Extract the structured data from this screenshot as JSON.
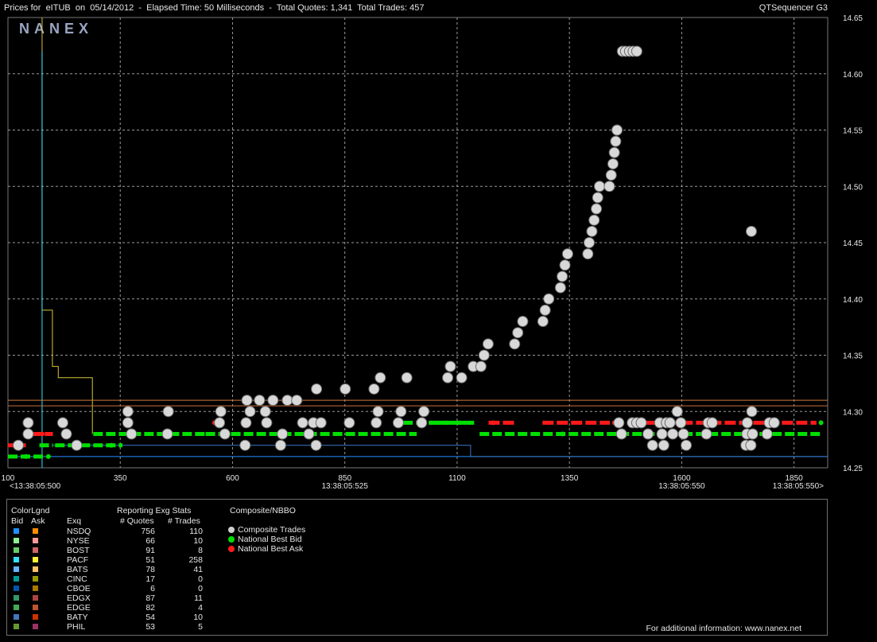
{
  "header": {
    "title": "Prices for  eITUB  on  05/14/2012  -  Elapsed Time: 50 Milliseconds  -  Total Quotes: 1,341  Total Trades: 457",
    "app_name": "QTSequencer G3",
    "watermark": "NANEX"
  },
  "chart_data": {
    "type": "scatter",
    "x_ticks": [
      {
        "value": 100,
        "label": "100"
      },
      {
        "value": 350,
        "label": "350"
      },
      {
        "value": 600,
        "label": "600"
      },
      {
        "value": 850,
        "label": "850"
      },
      {
        "value": 1100,
        "label": "1100"
      },
      {
        "value": 1350,
        "label": "1350"
      },
      {
        "value": 1600,
        "label": "1600"
      },
      {
        "value": 1850,
        "label": "1850"
      }
    ],
    "time_labels": [
      {
        "value": 100,
        "label": "<13:38:05:500"
      },
      {
        "value": 850,
        "label": "13:38:05:525"
      },
      {
        "value": 1600,
        "label": "13:38:05:550"
      },
      {
        "value": 1925,
        "label": "13:38:05:550>"
      }
    ],
    "y_ticks": [
      14.25,
      14.3,
      14.35,
      14.4,
      14.45,
      14.5,
      14.55,
      14.6,
      14.65
    ],
    "xlim": [
      100,
      1925
    ],
    "ylim": [
      14.25,
      14.65
    ],
    "grid": true,
    "colors": {
      "trades": "#d8d8d8",
      "bid": "#00e000",
      "ask": "#ff1a1a",
      "grid": "#9a9a9a"
    },
    "composite_trades": [
      [
        123,
        14.27
      ],
      [
        145,
        14.28
      ],
      [
        145,
        14.29
      ],
      [
        222,
        14.29
      ],
      [
        230,
        14.28
      ],
      [
        253,
        14.27
      ],
      [
        367,
        14.29
      ],
      [
        367,
        14.3
      ],
      [
        375,
        14.28
      ],
      [
        455,
        14.28
      ],
      [
        457,
        14.3
      ],
      [
        571,
        14.29
      ],
      [
        574,
        14.3
      ],
      [
        583,
        14.28
      ],
      [
        628,
        14.27
      ],
      [
        630,
        14.29
      ],
      [
        632,
        14.31
      ],
      [
        639,
        14.3
      ],
      [
        660,
        14.31
      ],
      [
        673,
        14.3
      ],
      [
        676,
        14.29
      ],
      [
        690,
        14.31
      ],
      [
        707,
        14.27
      ],
      [
        711,
        14.28
      ],
      [
        722,
        14.31
      ],
      [
        743,
        14.31
      ],
      [
        756,
        14.29
      ],
      [
        770,
        14.28
      ],
      [
        780,
        14.29
      ],
      [
        786,
        14.27
      ],
      [
        787,
        14.32
      ],
      [
        797,
        14.29
      ],
      [
        851,
        14.32
      ],
      [
        860,
        14.29
      ],
      [
        915,
        14.32
      ],
      [
        920,
        14.29
      ],
      [
        924,
        14.3
      ],
      [
        929,
        14.33
      ],
      [
        969,
        14.29
      ],
      [
        975,
        14.3
      ],
      [
        988,
        14.33
      ],
      [
        1021,
        14.29
      ],
      [
        1026,
        14.3
      ],
      [
        1079,
        14.33
      ],
      [
        1085,
        14.34
      ],
      [
        1110,
        14.33
      ],
      [
        1136,
        14.34
      ],
      [
        1153,
        14.34
      ],
      [
        1160,
        14.35
      ],
      [
        1169,
        14.36
      ],
      [
        1228,
        14.36
      ],
      [
        1235,
        14.37
      ],
      [
        1246,
        14.38
      ],
      [
        1291,
        14.38
      ],
      [
        1296,
        14.39
      ],
      [
        1304,
        14.4
      ],
      [
        1330,
        14.41
      ],
      [
        1334,
        14.42
      ],
      [
        1340,
        14.43
      ],
      [
        1346,
        14.44
      ],
      [
        1391,
        14.44
      ],
      [
        1394,
        14.45
      ],
      [
        1400,
        14.46
      ],
      [
        1405,
        14.47
      ],
      [
        1410,
        14.48
      ],
      [
        1413,
        14.49
      ],
      [
        1417,
        14.5
      ],
      [
        1439,
        14.5
      ],
      [
        1443,
        14.51
      ],
      [
        1447,
        14.52
      ],
      [
        1450,
        14.53
      ],
      [
        1453,
        14.54
      ],
      [
        1456,
        14.55
      ],
      [
        1468,
        14.62
      ],
      [
        1475,
        14.62
      ],
      [
        1484,
        14.62
      ],
      [
        1492,
        14.62
      ],
      [
        1500,
        14.62
      ],
      [
        1460,
        14.29
      ],
      [
        1466,
        14.28
      ],
      [
        1490,
        14.29
      ],
      [
        1500,
        14.29
      ],
      [
        1510,
        14.29
      ],
      [
        1525,
        14.28
      ],
      [
        1535,
        14.27
      ],
      [
        1551,
        14.29
      ],
      [
        1556,
        14.28
      ],
      [
        1560,
        14.27
      ],
      [
        1566,
        14.29
      ],
      [
        1574,
        14.29
      ],
      [
        1580,
        14.28
      ],
      [
        1590,
        14.3
      ],
      [
        1598,
        14.29
      ],
      [
        1604,
        14.28
      ],
      [
        1610,
        14.27
      ],
      [
        1655,
        14.28
      ],
      [
        1659,
        14.29
      ],
      [
        1668,
        14.29
      ],
      [
        1755,
        14.46
      ],
      [
        1746,
        14.29
      ],
      [
        1745,
        14.28
      ],
      [
        1743,
        14.27
      ],
      [
        1758,
        14.28
      ],
      [
        1756,
        14.3
      ],
      [
        1754,
        14.27
      ],
      [
        1790,
        14.28
      ],
      [
        1795,
        14.29
      ],
      [
        1806,
        14.29
      ]
    ],
    "bid_segments": [
      [
        100,
        185,
        14.26
      ],
      [
        170,
        200,
        14.27
      ],
      [
        205,
        355,
        14.27
      ],
      [
        290,
        540,
        14.28
      ],
      [
        540,
        1010,
        14.28
      ],
      [
        980,
        1060,
        14.29
      ],
      [
        1060,
        1140,
        14.29
      ],
      [
        1150,
        1910,
        14.28
      ],
      [
        1040,
        1130,
        14.29
      ]
    ],
    "ask_segments": [
      [
        100,
        140,
        14.27
      ],
      [
        150,
        200,
        14.28
      ],
      [
        1170,
        1230,
        14.29
      ],
      [
        1290,
        1440,
        14.29
      ],
      [
        1520,
        1560,
        14.29
      ],
      [
        1600,
        1900,
        14.29
      ]
    ],
    "bid_markers": [
      [
        140,
        14.26
      ],
      [
        190,
        14.26
      ],
      [
        250,
        14.27
      ],
      [
        330,
        14.27
      ],
      [
        1335,
        14.28
      ],
      [
        1910,
        14.29
      ]
    ],
    "ask_markers": [
      [
        114,
        14.27
      ],
      [
        176,
        14.28
      ],
      [
        560,
        14.29
      ],
      [
        1180,
        14.29
      ],
      [
        1450,
        14.29
      ]
    ]
  },
  "legend": {
    "color_legend_title": "ColorLgnd",
    "bid_header": "Bid",
    "ask_header": "Ask",
    "exchange_header": "Exq",
    "stats_title": "Reporting Exg Stats",
    "quotes_header": "# Quotes",
    "trades_header": "# Trades",
    "composite_title": "Composite/NBBO",
    "composite_items": [
      {
        "label": "Composite Trades",
        "color": "#cfcfcf"
      },
      {
        "label": "National Best Bid",
        "color": "#00e000"
      },
      {
        "label": "National Best Ask",
        "color": "#ff1a1a"
      }
    ],
    "exchanges": [
      {
        "name": "NSDQ",
        "quotes": "756",
        "trades": "110",
        "bid_color": "#1e90ff",
        "ask_color": "#ff8c00"
      },
      {
        "name": "NYSE",
        "quotes": "66",
        "trades": "10",
        "bid_color": "#90ee90",
        "ask_color": "#ff9999"
      },
      {
        "name": "BOST",
        "quotes": "91",
        "trades": "8",
        "bid_color": "#66cc66",
        "ask_color": "#cc6666"
      },
      {
        "name": "PACF",
        "quotes": "51",
        "trades": "258",
        "bid_color": "#33e0ff",
        "ask_color": "#ffee33"
      },
      {
        "name": "BATS",
        "quotes": "78",
        "trades": "41",
        "bid_color": "#66b3ff",
        "ask_color": "#ffc266"
      },
      {
        "name": "CINC",
        "quotes": "17",
        "trades": "0",
        "bid_color": "#009999",
        "ask_color": "#999900"
      },
      {
        "name": "CBOE",
        "quotes": "6",
        "trades": "0",
        "bid_color": "#0055aa",
        "ask_color": "#aa7700"
      },
      {
        "name": "EDGX",
        "quotes": "87",
        "trades": "11",
        "bid_color": "#339966",
        "ask_color": "#aa4444"
      },
      {
        "name": "EDGE",
        "quotes": "82",
        "trades": "4",
        "bid_color": "#44aa55",
        "ask_color": "#bb5533"
      },
      {
        "name": "BATY",
        "quotes": "54",
        "trades": "10",
        "bid_color": "#4477bb",
        "ask_color": "#cc3300"
      },
      {
        "name": "PHIL",
        "quotes": "53",
        "trades": "5",
        "bid_color": "#669933",
        "ask_color": "#993366"
      }
    ],
    "footer": "For additional information: www.nanex.net"
  }
}
